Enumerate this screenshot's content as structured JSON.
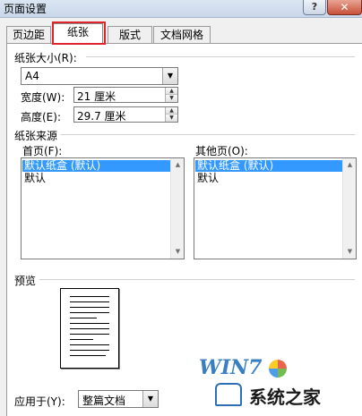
{
  "window": {
    "title": "页面设置",
    "help": "?",
    "close": "✕"
  },
  "tabs": [
    {
      "label": "页边距",
      "active": false
    },
    {
      "label": "纸张",
      "active": true
    },
    {
      "label": "版式",
      "active": false
    },
    {
      "label": "文档网格",
      "active": false
    }
  ],
  "paper_size": {
    "label": "纸张大小(R):",
    "value": "A4",
    "width_label": "宽度(W):",
    "width_value": "21 厘米",
    "height_label": "高度(E):",
    "height_value": "29.7 厘米"
  },
  "paper_source": {
    "label": "纸张来源",
    "first_page_label": "首页(F):",
    "first_page_items": [
      "默认纸盒 (默认)",
      "默认"
    ],
    "first_page_selected": 0,
    "other_pages_label": "其他页(O):",
    "other_pages_items": [
      "默认纸盒 (默认)",
      "默认"
    ],
    "other_pages_selected": 0
  },
  "preview": {
    "label": "预览"
  },
  "apply_to": {
    "label": "应用于(Y):",
    "value": "整篇文档"
  },
  "watermark": {
    "logo": "WIN7",
    "site": "系统之家"
  },
  "colors": {
    "selection": "#3399ff",
    "highlight_border": "#e0242b"
  }
}
